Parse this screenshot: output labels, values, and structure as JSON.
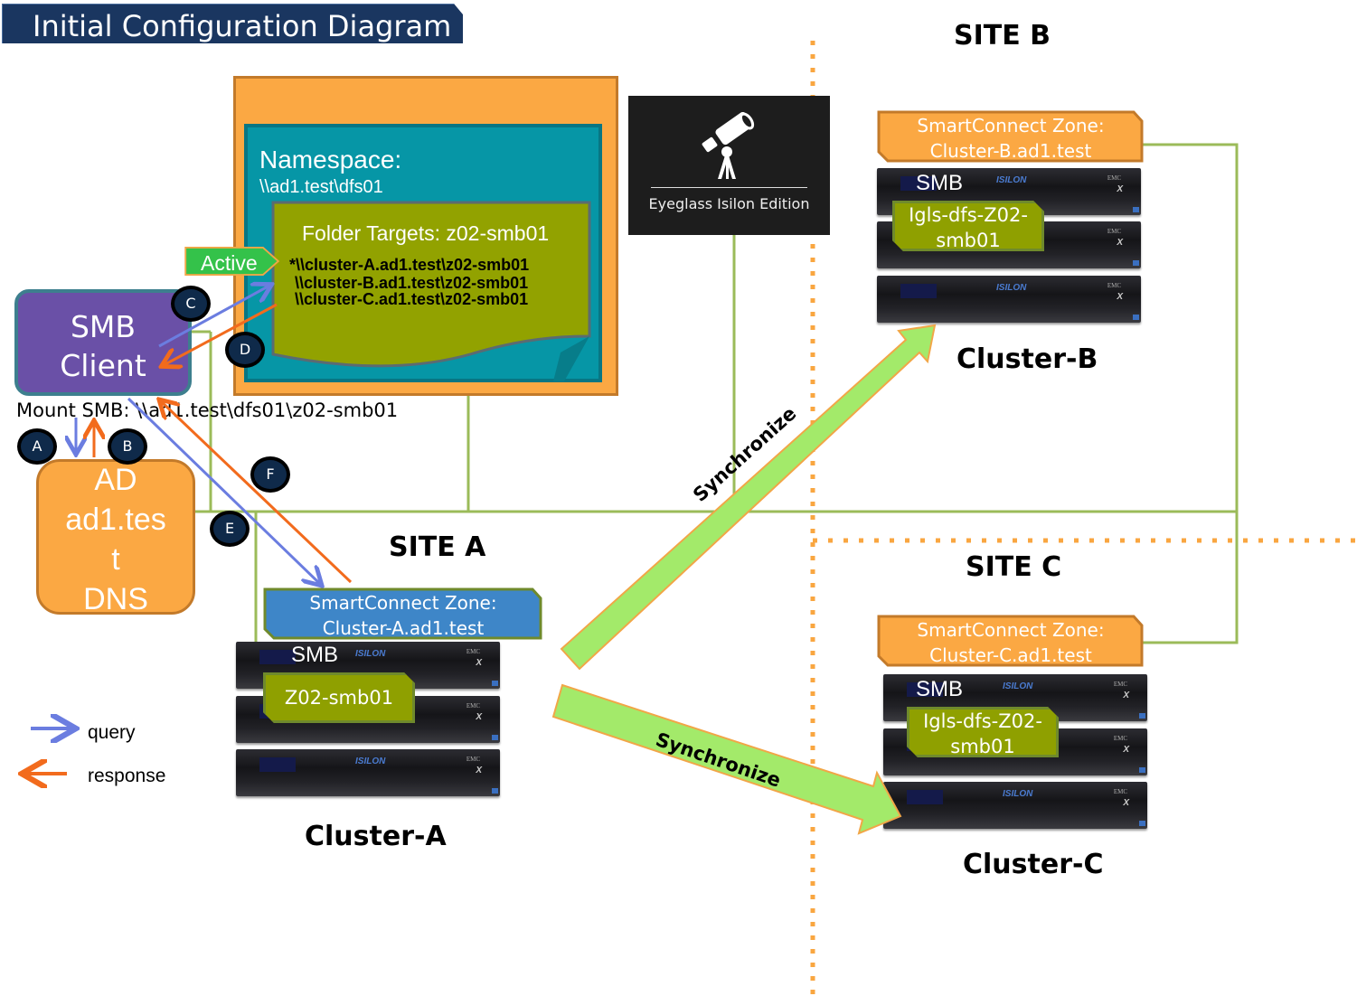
{
  "title": "Initial Configuration Diagram",
  "sites": {
    "a": "SITE A",
    "b": "SITE B",
    "c": "SITE C"
  },
  "namespace": {
    "title": "Namespace:",
    "path": "\\\\ad1.test\\dfs01",
    "folder_targets_title": "Folder Targets: z02-smb01",
    "targets": [
      "*\\\\cluster-A.ad1.test\\z02-smb01",
      "\\\\cluster-B.ad1.test\\z02-smb01",
      "\\\\cluster-C.ad1.test\\z02-smb01"
    ],
    "active_tag": "Active"
  },
  "smb_client": {
    "line1": "SMB",
    "line2": "Client",
    "mount": "Mount SMB: \\\\ad1.test\\dfs01\\z02-smb01"
  },
  "ad": {
    "lines": [
      "AD",
      "ad1.tes",
      "t",
      "DNS"
    ]
  },
  "steps": [
    "A",
    "B",
    "C",
    "D",
    "E",
    "F"
  ],
  "eyeglass": {
    "label": "Eyeglass Isilon Edition",
    "icon": "telescope-icon"
  },
  "clusters": {
    "a": {
      "name": "Cluster-A",
      "zone_line1": "SmartConnect Zone:",
      "zone_line2": "Cluster-A.ad1.test",
      "protocol": "SMB",
      "share": "Z02-smb01",
      "zone_color": "#3e86c8"
    },
    "b": {
      "name": "Cluster-B",
      "zone_line1": "SmartConnect Zone:",
      "zone_line2": "Cluster-B.ad1.test",
      "protocol": "SMB",
      "share_line1": "Igls-dfs-Z02-",
      "share_line2": "smb01",
      "zone_color": "#fba843"
    },
    "c": {
      "name": "Cluster-C",
      "zone_line1": "SmartConnect Zone:",
      "zone_line2": "Cluster-C.ad1.test",
      "protocol": "SMB",
      "share_line1": "Igls-dfs-Z02-",
      "share_line2": "smb01",
      "zone_color": "#fba843"
    }
  },
  "server_brand": {
    "logo": "ISILON",
    "vendor": "EMC",
    "model": "X"
  },
  "sync": {
    "to_b": "Synchronize",
    "to_c": "Synchronize"
  },
  "legend": {
    "query": "query",
    "response": "response",
    "query_color": "#6b7de0",
    "response_color": "#f26b1d"
  },
  "colors": {
    "network_line": "#9bbb59",
    "site_divider": "#f9a640",
    "sync_arrow": "#a3ea6a"
  }
}
